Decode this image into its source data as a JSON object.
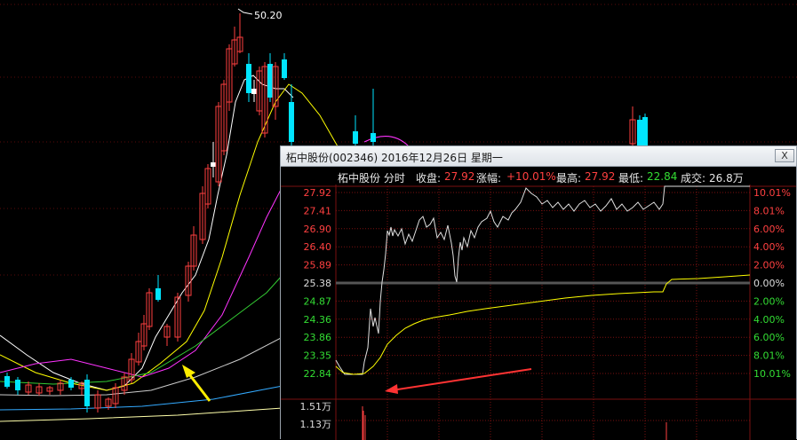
{
  "background_chart": {
    "peak_label": "50.20",
    "colors": {
      "up": "#ff4040",
      "down": "#00e5ff",
      "ma5": "#ffffff",
      "ma10": "#ffff00",
      "ma20": "#ff33ff",
      "ma30": "#33cc33",
      "ma60": "#cccccc",
      "ma120": "#33aaff",
      "ma250": "#ffffaa"
    }
  },
  "popup": {
    "title": "柘中股份(002346) 2016年12月26日 星期一",
    "close_label": "X",
    "info": {
      "name": "柘中股份 分时",
      "close_label": "收盘:",
      "close_value": "27.92",
      "change_label": "涨幅:",
      "change_value": "+10.01%",
      "high_label": "最高:",
      "high_value": "27.92",
      "low_label": "最低:",
      "low_value": "22.84",
      "volume_label": "成交:",
      "volume_value": "26.8万"
    },
    "price_axis": [
      "27.92",
      "27.41",
      "26.90",
      "26.40",
      "25.89",
      "25.38",
      "24.87",
      "24.36",
      "23.86",
      "23.35",
      "22.84"
    ],
    "pct_axis": [
      "10.01%",
      "8.01%",
      "6.00%",
      "4.00%",
      "2.00%",
      "0.00%",
      "2.00%",
      "4.00%",
      "6.00%",
      "8.01%",
      "10.01%"
    ],
    "volume_axis": [
      "1.51万",
      "1.13万"
    ],
    "colors": {
      "price_line": "#e0e0e0",
      "avg_line": "#ffff00",
      "red": "#ff4040",
      "green": "#33dd33",
      "grid": "#7a1010"
    }
  }
}
